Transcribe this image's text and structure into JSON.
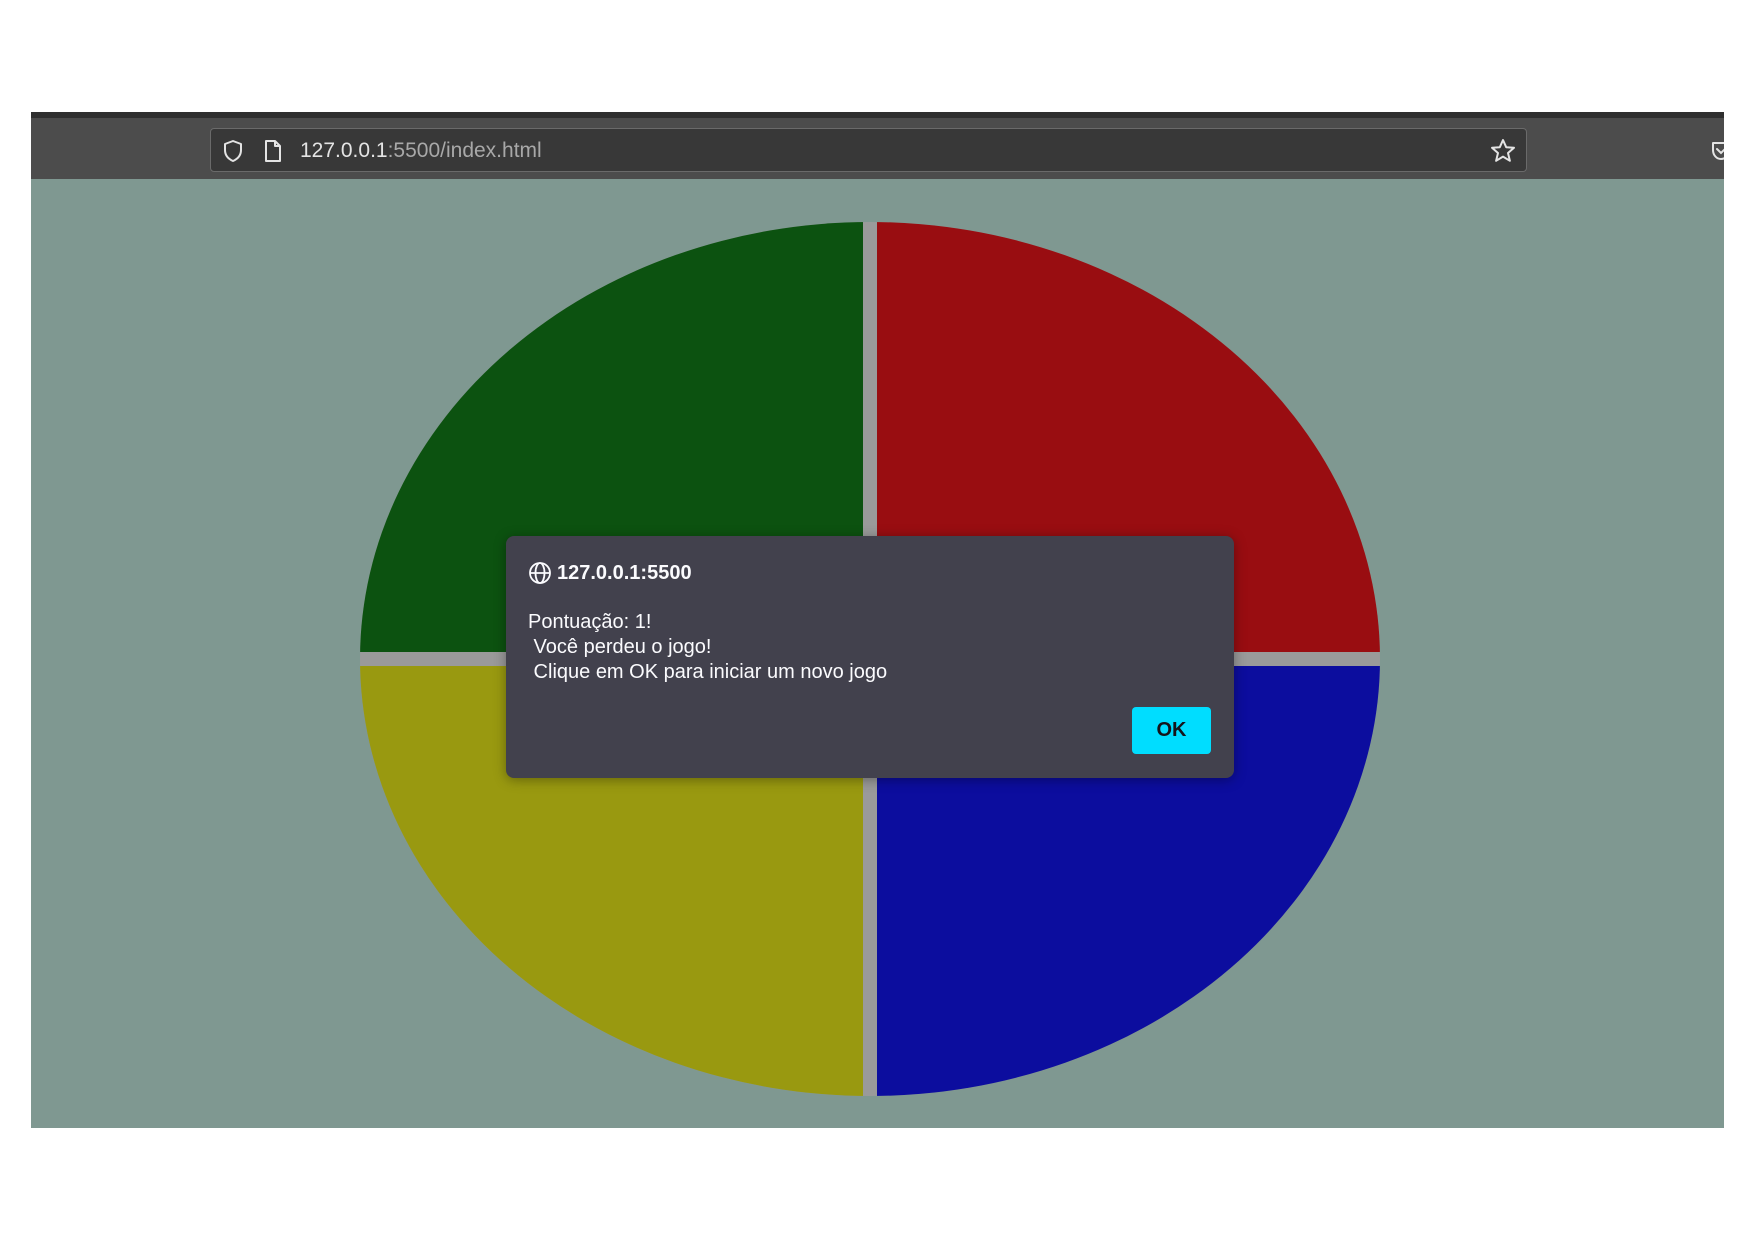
{
  "browser": {
    "url_host": "127.0.0.1",
    "url_rest": ":5500/index.html",
    "icons": {
      "shield": "shield-icon",
      "page": "page-icon",
      "bookmark": "star-icon",
      "pocket": "pocket-icon"
    }
  },
  "game": {
    "quadrants": [
      {
        "name": "green",
        "color": "#0c5210"
      },
      {
        "name": "red",
        "color": "#990d11"
      },
      {
        "name": "yellow",
        "color": "#999910"
      },
      {
        "name": "blue",
        "color": "#0c0d9e"
      }
    ],
    "separator_color": "#9a9a9a",
    "background_color": "#7f9891"
  },
  "dialog": {
    "origin": "127.0.0.1:5500",
    "message": "Pontuação: 1!\n Você perdeu o jogo!\n Clique em OK para iniciar um novo jogo",
    "ok_label": "OK",
    "accent_color": "#00ddff"
  }
}
